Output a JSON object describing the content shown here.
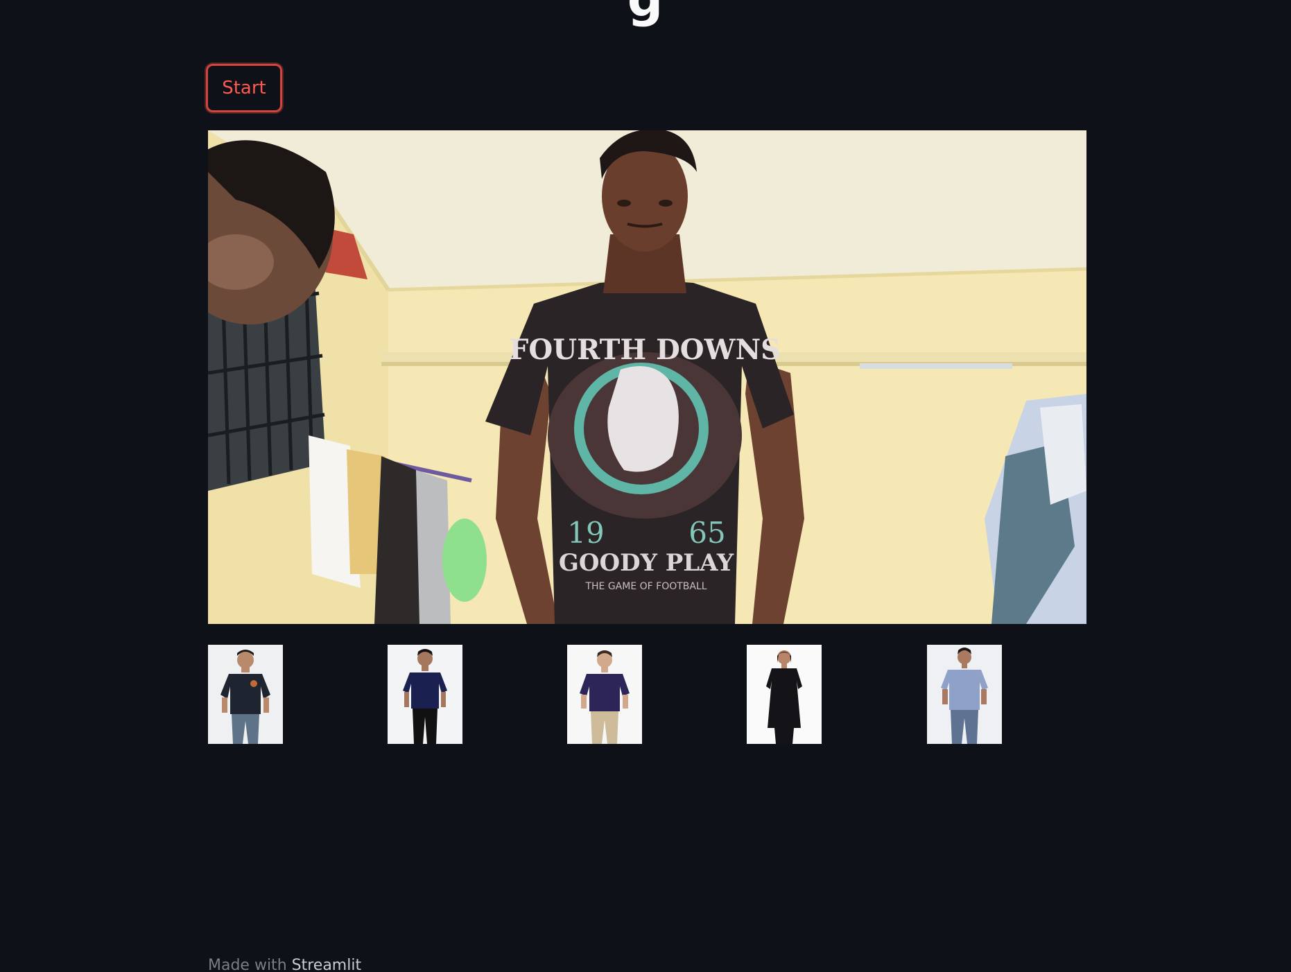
{
  "app": {
    "title": "g"
  },
  "controls": {
    "start_label": "Start"
  },
  "webcam": {
    "shirt_print": {
      "top_text": "FOURTH DOWNS",
      "year_left": "19",
      "year_right": "65",
      "bottom_text": "GOODY PLAY",
      "tagline": "THE GAME OF FOOTBALL"
    }
  },
  "recommendations": [
    {
      "name": "navy polo with badge",
      "shirt_color": "#1f2530",
      "bottom_color": "#5e7388",
      "bg": "#eef0f2"
    },
    {
      "name": "navy polo",
      "shirt_color": "#1a2050",
      "bottom_color": "#111111",
      "bg": "#f3f4f6"
    },
    {
      "name": "purple polo",
      "shirt_color": "#2d2557",
      "bottom_color": "#cdbb9a",
      "bg": "#f7f7f8"
    },
    {
      "name": "black kurta",
      "shirt_color": "#141418",
      "bottom_color": "#141418",
      "bg": "#fafafa"
    },
    {
      "name": "blue check shirt",
      "shirt_color": "#8fa0c9",
      "bottom_color": "#5d7391",
      "bg": "#eef0f4"
    }
  ],
  "footer": {
    "prefix": "Made with ",
    "brand": "Streamlit"
  },
  "colors": {
    "background": "#0e1117",
    "accent": "#ff4b4b"
  }
}
